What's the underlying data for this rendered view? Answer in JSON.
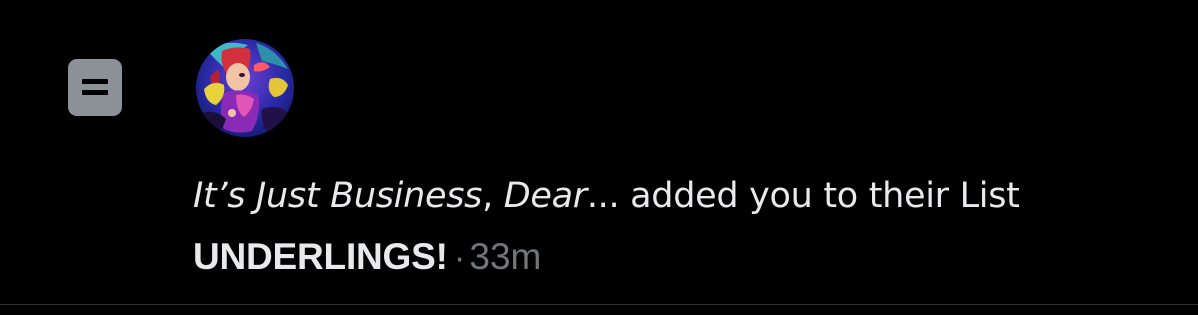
{
  "notification": {
    "actor_name_part1": "It’s Just Business",
    "actor_name_separator": ", ",
    "actor_name_part2": "Dear",
    "actor_name_ellipsis": "...",
    "action_text": " added you to their List",
    "list_name": "UNDERLINGS!",
    "separator_dot": "·",
    "timestamp": "33m"
  },
  "icons": {
    "type_icon": "list-icon",
    "avatar": "profile-avatar"
  },
  "colors": {
    "background": "#000000",
    "primary_text": "#e7e9ea",
    "secondary_text": "#71767b",
    "list_icon_bg": "#8b9197",
    "divider": "#2f3336"
  }
}
